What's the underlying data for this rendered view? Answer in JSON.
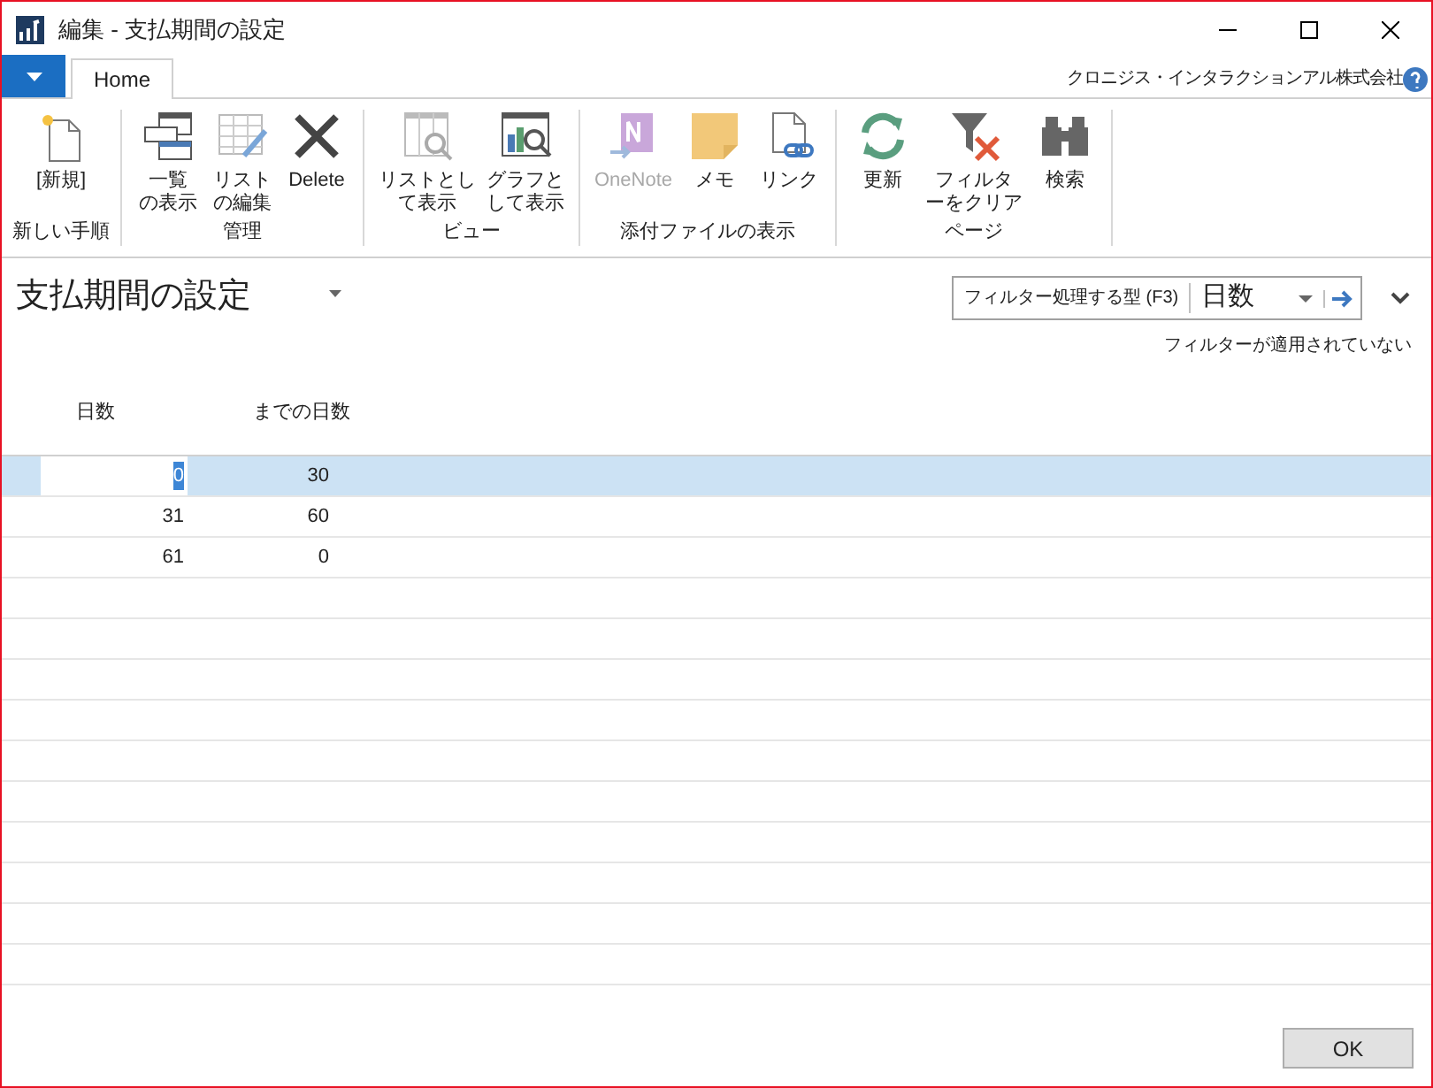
{
  "window": {
    "title": "編集 - 支払期間の設定"
  },
  "tabs": [
    {
      "label": "Home",
      "selected": true
    }
  ],
  "company": "クロニジス・インタラクションアル株式会社",
  "ribbon": [
    {
      "group": "新しい手順",
      "items": [
        {
          "kind": "new",
          "lines": [
            "[新規]"
          ],
          "disabled": false
        }
      ]
    },
    {
      "group": "管理",
      "items": [
        {
          "kind": "list",
          "lines": [
            "一覧",
            "の表示"
          ],
          "disabled": false
        },
        {
          "kind": "edit",
          "lines": [
            "リスト",
            "の編集"
          ],
          "disabled": false
        },
        {
          "kind": "delete",
          "lines": [
            "Delete"
          ],
          "disabled": false
        }
      ]
    },
    {
      "group": "ビュー",
      "items": [
        {
          "kind": "listview",
          "lines": [
            "リストとし",
            "て表示"
          ],
          "disabled": false
        },
        {
          "kind": "chart",
          "lines": [
            "グラフと",
            "して表示"
          ],
          "disabled": false
        }
      ]
    },
    {
      "group": "添付ファイルの表示",
      "items": [
        {
          "kind": "onenote",
          "lines": [
            "OneNote"
          ],
          "disabled": true
        },
        {
          "kind": "note",
          "lines": [
            "メモ"
          ],
          "disabled": false
        },
        {
          "kind": "link",
          "lines": [
            "リンク"
          ],
          "disabled": false
        }
      ]
    },
    {
      "group": "ページ",
      "items": [
        {
          "kind": "refresh",
          "lines": [
            "更新"
          ],
          "disabled": false
        },
        {
          "kind": "clearfilter",
          "lines": [
            "フィルタ",
            "ーをクリア"
          ],
          "disabled": false
        },
        {
          "kind": "find",
          "lines": [
            "検索"
          ],
          "disabled": false
        }
      ]
    }
  ],
  "page": {
    "title": "支払期間の設定"
  },
  "filter": {
    "label": "フィルター処理する型 (F3)",
    "value": "日数",
    "status": "フィルターが適用されていない"
  },
  "table": {
    "columns": [
      "日数",
      "までの日数"
    ],
    "rows": [
      {
        "cells": [
          "0",
          "30"
        ],
        "selected": true
      },
      {
        "cells": [
          "31",
          "60"
        ],
        "selected": false
      },
      {
        "cells": [
          "61",
          "0"
        ],
        "selected": false
      }
    ]
  },
  "buttons": [
    "OK"
  ]
}
